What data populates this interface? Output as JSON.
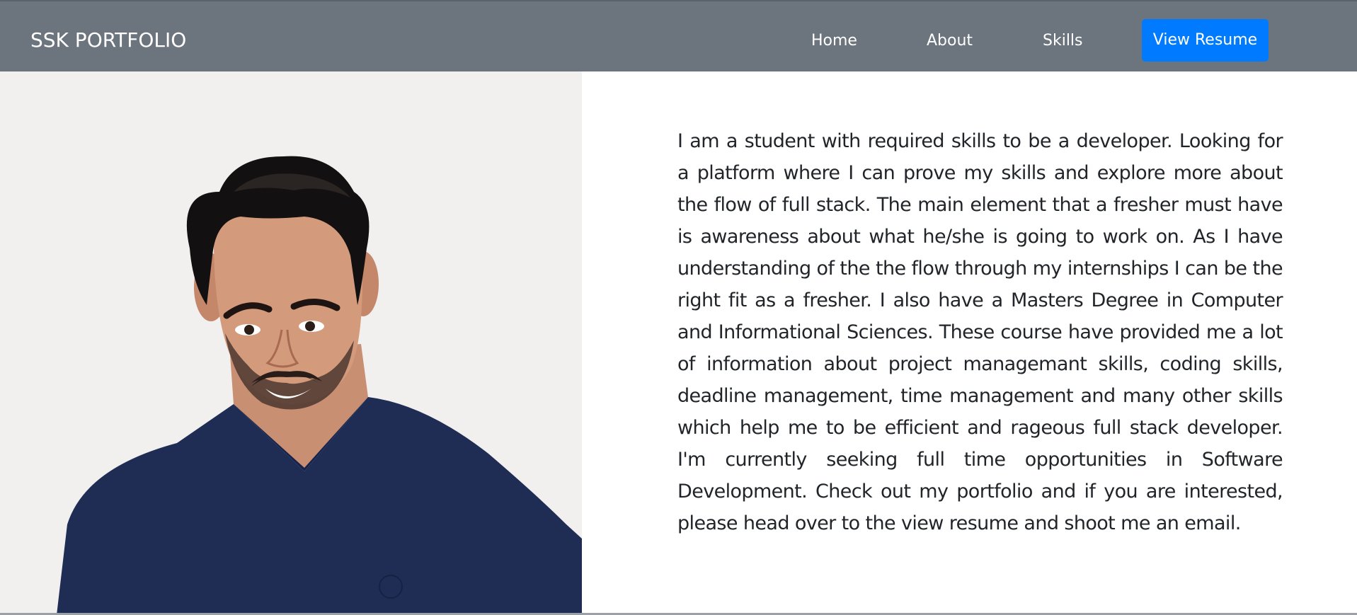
{
  "navbar": {
    "brand": "SSK PORTFOLIO",
    "links": [
      {
        "label": "Home"
      },
      {
        "label": "About"
      },
      {
        "label": "Skills"
      }
    ],
    "resume_button": "View Resume"
  },
  "colors": {
    "navbar_bg": "#6c757d",
    "button_bg": "#007bff",
    "text": "#212529",
    "shirt": "#1f2d55",
    "photo_bg": "#f0efed"
  },
  "about": {
    "paragraph": "I am a student with required skills to be a developer. Looking for a platform where I can prove my skills and explore more about the flow of full stack. The main element that a fresher must have is awareness about what he/she is going to work on. As I have understanding of the the flow through my internships I can be the right fit as a fresher. I also have a Masters Degree in Computer and Informational Sciences. These course have provided me a lot of information about project managemant skills, coding skills, deadline management, time management and many other skills which help me to be efficient and rageous full stack developer. I'm currently seeking full time opportunities in Software Development. Check out my portfolio and if you are interested, please head over to the view resume and shoot me an email."
  },
  "icons": {
    "portrait": "profile-photo"
  }
}
